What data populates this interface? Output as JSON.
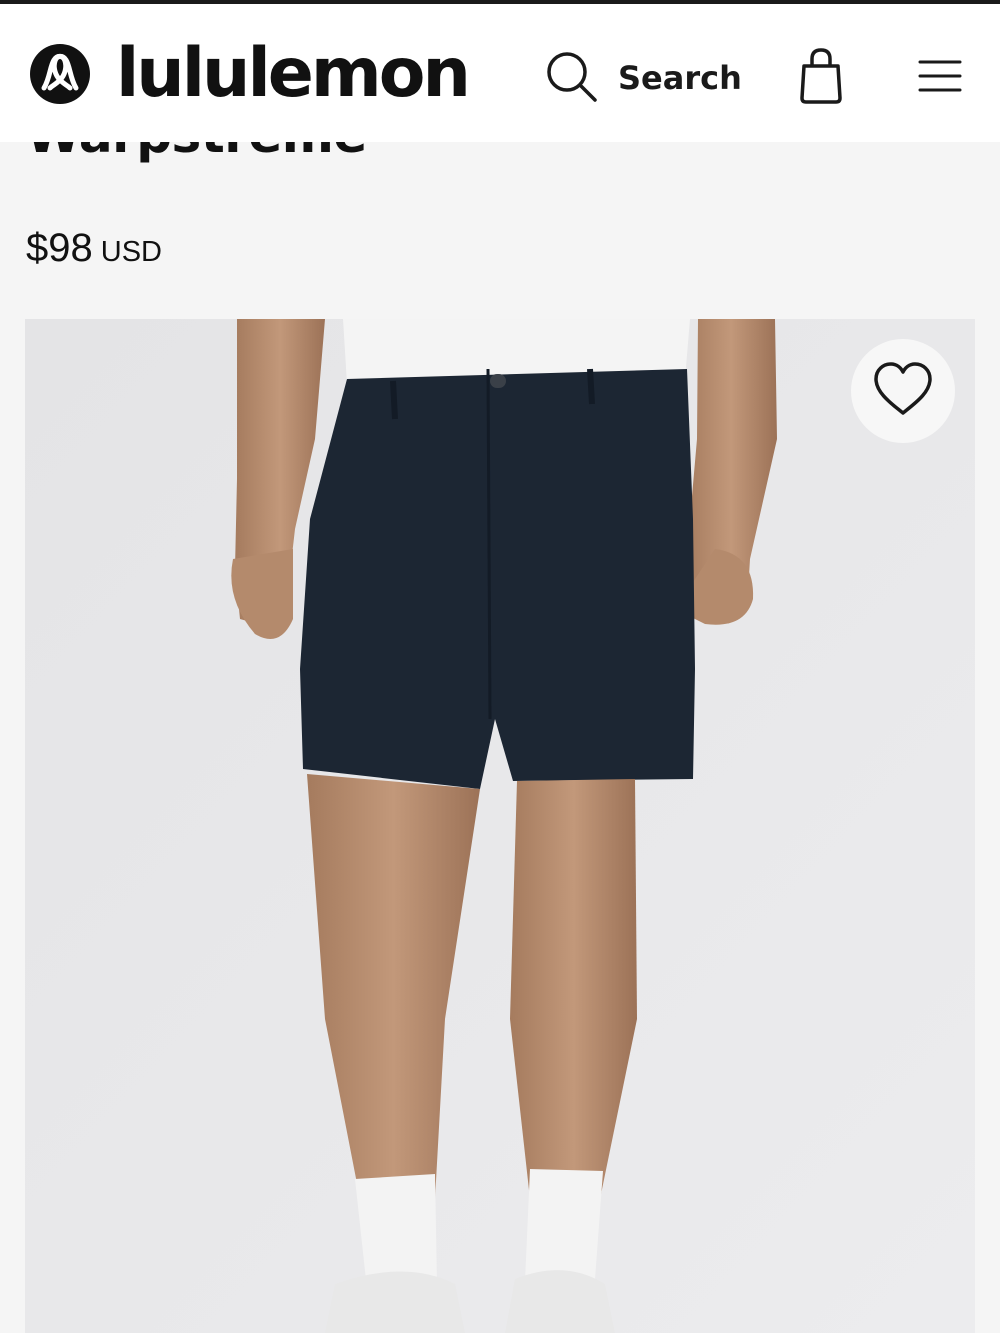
{
  "header": {
    "brand": "lululemon",
    "search_label": "Search",
    "icons": {
      "logo": "lululemon-logo-icon",
      "search": "search-icon",
      "bag": "shopping-bag-icon",
      "menu": "hamburger-menu-icon"
    }
  },
  "product": {
    "title": "Warpstreme",
    "price": "$98",
    "currency": "USD",
    "wishlist_icon": "heart-icon",
    "image_alt": "Model wearing navy shorts with white t-shirt and white socks"
  },
  "colors": {
    "header_bg": "#ffffff",
    "page_bg": "#f5f5f5",
    "text": "#1a1a1a",
    "shorts": "#1c2633"
  }
}
